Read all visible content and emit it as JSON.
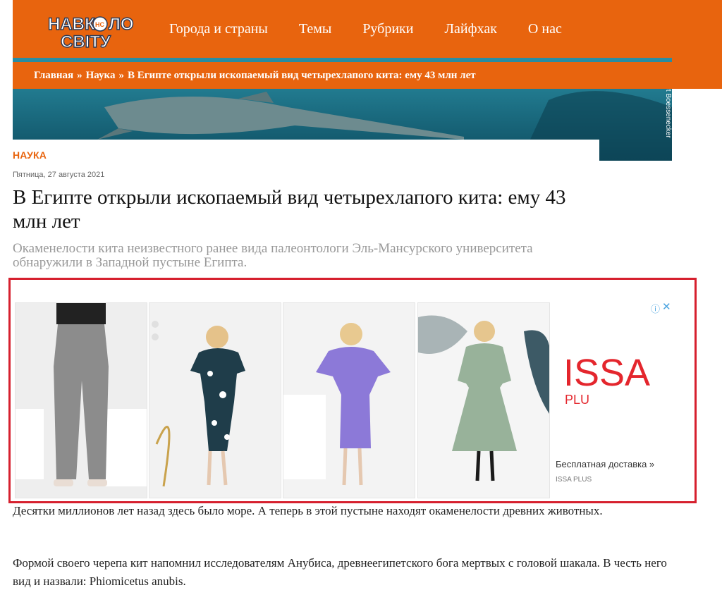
{
  "brand": {
    "logo_line1": "НАВК",
    "logo_badge": "НС",
    "logo_line1_end": "ЛО",
    "logo_line2": "СВІТУ"
  },
  "nav": {
    "items": [
      {
        "label": "Города и страны"
      },
      {
        "label": "Темы"
      },
      {
        "label": "Рубрики"
      },
      {
        "label": "Лайфхак"
      },
      {
        "label": "О нас"
      }
    ]
  },
  "breadcrumb": {
    "home": "Главная",
    "section": "Наука",
    "separator": "»",
    "current": "В Египте открыли ископаемый вид четырехлапого кита: ему 43 млн лет"
  },
  "hero": {
    "credit": "ert Boessenecker"
  },
  "article": {
    "category": "НАУКА",
    "date": "Пятница, 27 августа 2021",
    "title": "В Египте открыли ископаемый вид четырехлапого кита: ему 43 млн лет",
    "lead": "Окаменелости кита неизвестного ранее вида палеонтологи Эль-Мансурского университета обнаружили в Западной пустыне Египта.",
    "paragraphs": [
      "Десятки миллионов лет назад здесь было море. А теперь в этой пустыне находят окаменелости древних животных.",
      "Формой своего черепа кит напомнил исследователям Анубиса, древнеегипетского бога мертвых с головой шакала. В честь него вид и назвали: Phiomicetus anubis."
    ]
  },
  "ad": {
    "info_icon": "info-icon",
    "close_icon": "close-icon",
    "brand_text": "ISSA",
    "brand_sub": "PLU",
    "cta": "Бесплатная доставка »",
    "advertiser": "ISSA PLUS",
    "colors": {
      "border": "#d6202e",
      "brand": "#e4262d",
      "adchoices": "#4aa3df"
    }
  },
  "colors": {
    "accent": "#e8640e",
    "title": "#111111",
    "lead": "#999999"
  }
}
